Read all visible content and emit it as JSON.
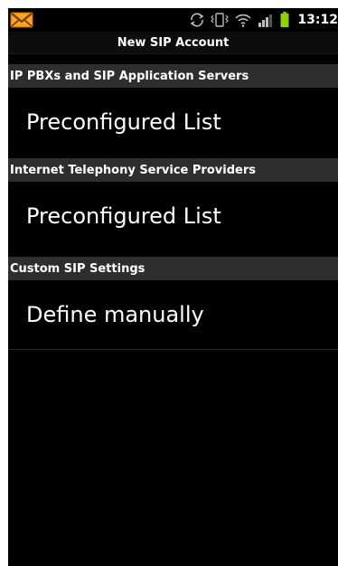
{
  "status_bar": {
    "time": "13:12",
    "icons": [
      "mail-icon",
      "sync-icon",
      "vibrate-icon",
      "wifi-icon",
      "signal-icon",
      "battery-icon"
    ]
  },
  "title": "New SIP Account",
  "sections": [
    {
      "header": "IP PBXs and SIP Application Servers",
      "item": "Preconfigured List"
    },
    {
      "header": "Internet Telephony Service Providers",
      "item": "Preconfigured List"
    },
    {
      "header": "Custom SIP Settings",
      "item": "Define manually"
    }
  ],
  "colors": {
    "background": "#000000",
    "section_header": "#2e2e2e",
    "text": "#ffffff",
    "mail_icon": "#f09020",
    "battery": "#8fd400"
  }
}
